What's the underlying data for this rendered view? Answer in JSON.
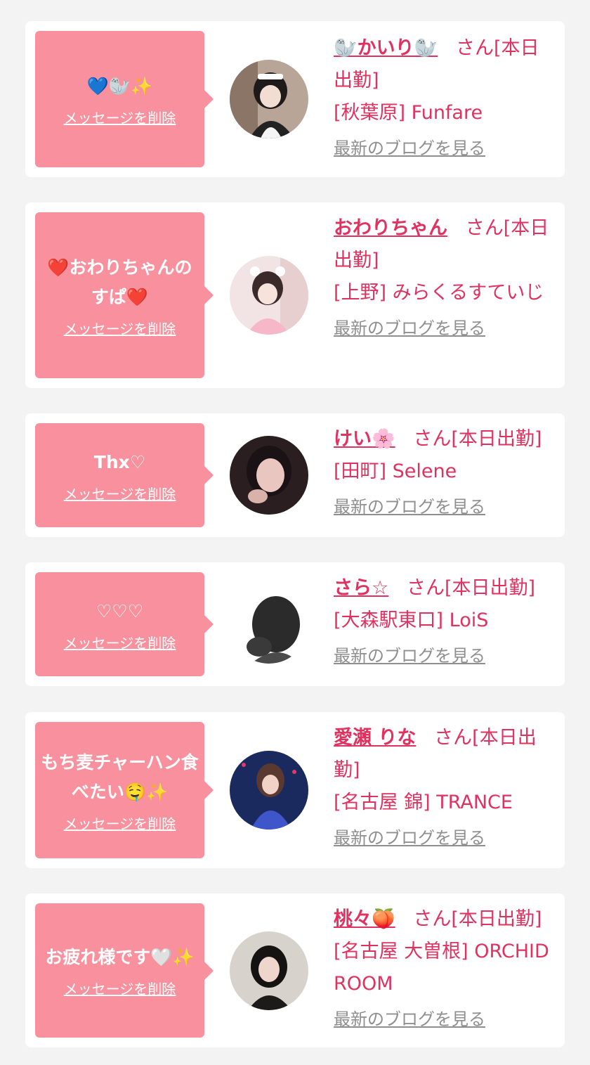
{
  "delete_label": "メッセージを削除",
  "blog_label": "最新のブログを見る",
  "colors": {
    "bubble": "#f8919d",
    "name": "#e0315f",
    "link_gray": "#8f8f8f",
    "background": "#f3f3f3",
    "card": "#ffffff"
  },
  "cards": [
    {
      "message": "💙🦭✨",
      "name": "🦭かいり🦭",
      "status": "さん[本日出勤]",
      "location": "[秋葉原] Funfare"
    },
    {
      "message": "❤️おわりちゃんのすぱ❤️",
      "name": "おわりちゃん",
      "status": "さん[本日出勤]",
      "location": "[上野] みらくるすていじ"
    },
    {
      "message": "Thx♡",
      "name": "けい🌸",
      "status": "さん[本日出勤]",
      "location": "[田町] Selene"
    },
    {
      "message": "♡♡♡",
      "name": "さら☆",
      "status": "さん[本日出勤]",
      "location": "[大森駅東口] LoiS"
    },
    {
      "message": "もち麦チャーハン食べたい🤤✨",
      "name": "愛瀬 りな",
      "status": "さん[本日出勤]",
      "location": "[名古屋 錦] TRANCE"
    },
    {
      "message": "お疲れ様です🤍✨",
      "name": "桃々🍑",
      "status": "さん[本日出勤]",
      "location": "[名古屋 大曽根] ORCHID ROOM"
    }
  ]
}
